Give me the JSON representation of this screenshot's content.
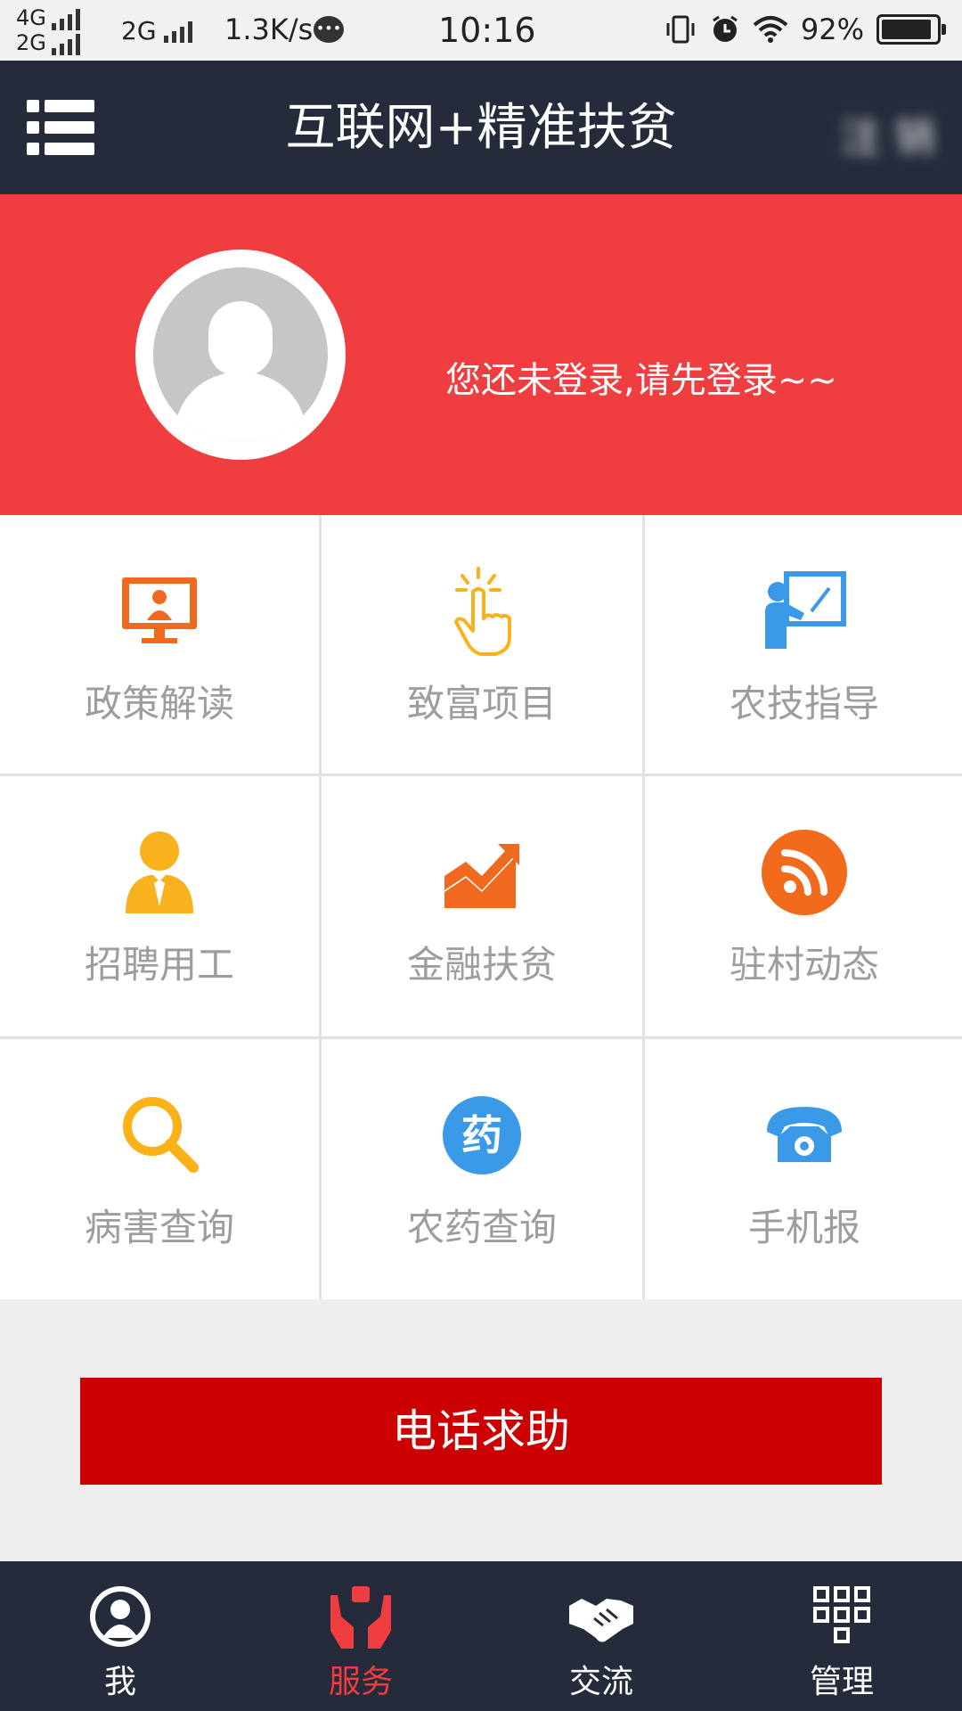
{
  "status_bar": {
    "net_top": "4G",
    "net_bottom": "2G",
    "net2": "2G",
    "speed": "1.3K/s",
    "time": "10:16",
    "battery": "92%",
    "battery_level": 0.92
  },
  "header": {
    "title": "互联网+精准扶贫",
    "right_label": "注 销"
  },
  "profile": {
    "login_hint": "您还未登录,请先登录~~"
  },
  "services": [
    {
      "label": "政策解读",
      "icon": "monitor-person-icon"
    },
    {
      "label": "致富项目",
      "icon": "tap-hand-icon"
    },
    {
      "label": "农技指导",
      "icon": "teacher-board-icon"
    },
    {
      "label": "招聘用工",
      "icon": "person-tie-icon"
    },
    {
      "label": "金融扶贫",
      "icon": "trend-chart-icon"
    },
    {
      "label": "驻村动态",
      "icon": "rss-icon"
    },
    {
      "label": "病害查询",
      "icon": "search-icon"
    },
    {
      "label": "农药查询",
      "icon": "pesticide-icon"
    },
    {
      "label": "手机报",
      "icon": "phone-icon"
    }
  ],
  "pesticide_glyph": "药",
  "help_button": "电话求助",
  "tabs": [
    {
      "label": "我",
      "icon": "user-icon"
    },
    {
      "label": "服务",
      "icon": "service-hands-icon"
    },
    {
      "label": "交流",
      "icon": "handshake-icon"
    },
    {
      "label": "管理",
      "icon": "grid-icon"
    }
  ],
  "colors": {
    "header_bg": "#252b3a",
    "banner_bg": "#f03e40",
    "help_bg": "#cc0000",
    "active_tab": "#f03e40"
  }
}
